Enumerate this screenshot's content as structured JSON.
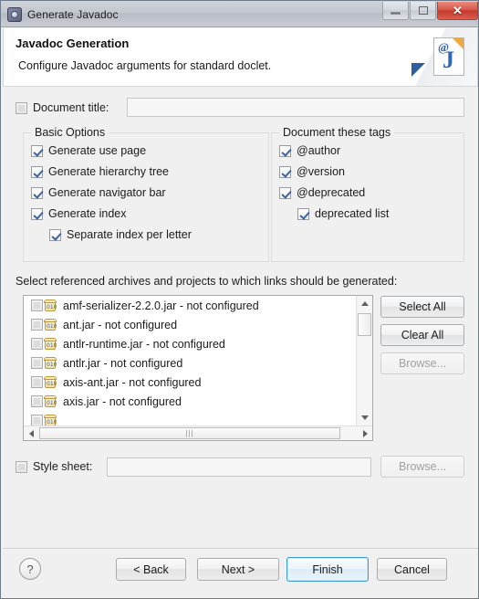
{
  "window": {
    "title": "Generate Javadoc",
    "title_icon": "gear-icon",
    "minimize_label": "",
    "maximize_label": "",
    "close_label": "✕"
  },
  "header": {
    "title": "Javadoc Generation",
    "description": "Configure Javadoc arguments for standard doclet.",
    "icon": "javadoc-page-icon",
    "icon_at": "@",
    "icon_letter": "J"
  },
  "document_title": {
    "label": "Document title:",
    "checked": false,
    "value": "",
    "placeholder": ""
  },
  "basic_options": {
    "title": "Basic Options",
    "items": [
      {
        "label": "Generate use page",
        "checked": true,
        "indent": 0
      },
      {
        "label": "Generate hierarchy tree",
        "checked": true,
        "indent": 0
      },
      {
        "label": "Generate navigator bar",
        "checked": true,
        "indent": 0
      },
      {
        "label": "Generate index",
        "checked": true,
        "indent": 0
      },
      {
        "label": "Separate index per letter",
        "checked": true,
        "indent": 1
      }
    ]
  },
  "document_tags": {
    "title": "Document these tags",
    "items": [
      {
        "label": "@author",
        "checked": true,
        "indent": 0
      },
      {
        "label": "@version",
        "checked": true,
        "indent": 0
      },
      {
        "label": "@deprecated",
        "checked": true,
        "indent": 0
      },
      {
        "label": "deprecated list",
        "checked": true,
        "indent": 1
      }
    ]
  },
  "referenced_archives": {
    "label": "Select referenced archives and projects to which links should be generated:",
    "items": [
      {
        "label": "amf-serializer-2.2.0.jar - not configured",
        "checked": false,
        "icon": "jar-icon"
      },
      {
        "label": "ant.jar - not configured",
        "checked": false,
        "icon": "jar-icon"
      },
      {
        "label": "antlr-runtime.jar - not configured",
        "checked": false,
        "icon": "jar-icon"
      },
      {
        "label": "antlr.jar - not configured",
        "checked": false,
        "icon": "jar-icon"
      },
      {
        "label": "axis-ant.jar - not configured",
        "checked": false,
        "icon": "jar-icon"
      },
      {
        "label": "axis.jar - not configured",
        "checked": false,
        "icon": "jar-icon"
      },
      {
        "label": "",
        "checked": false,
        "icon": "jar-icon"
      }
    ],
    "buttons": {
      "select_all": "Select All",
      "clear_all": "Clear All",
      "browse": "Browse...",
      "browse_disabled": true
    },
    "scrollbar_grip": "|||"
  },
  "style_sheet": {
    "label": "Style sheet:",
    "checked": false,
    "value": "",
    "browse": "Browse...",
    "browse_disabled": true
  },
  "footer": {
    "help_icon": "?",
    "back": "< Back",
    "next": "Next >",
    "finish": "Finish",
    "cancel": "Cancel",
    "default_button": "Finish"
  },
  "colors": {
    "accent": "#3c9bd6",
    "close_button": "#c4392c",
    "checkmark": "#3a62a8",
    "dialog_bg": "#f0f0f0"
  }
}
